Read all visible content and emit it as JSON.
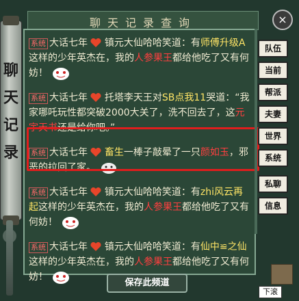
{
  "window": {
    "title": "聊天记录查询",
    "side_title": "聊天记录"
  },
  "buttons": {
    "close": "×",
    "save": "保存此频道",
    "scroll_down": "下滚"
  },
  "side_tabs": [
    "队伍",
    "当前",
    "帮派",
    "夫妻",
    "世界",
    "系统",
    "私聊",
    "信息"
  ],
  "messages": [
    {
      "tag": "系统",
      "parts": [
        "大话七年",
        "镇元大仙哈哈笑道：有",
        "师傅升级A",
        "这样的少年英杰在，我的",
        "人参果王",
        "都给他吃了又有何妨！"
      ]
    },
    {
      "tag": "系统",
      "parts": [
        "大话七年",
        "托塔李天王对",
        "SB点我11",
        "哭道：“我家哪吒玩性都突破2000大关了，洗不回去了，这",
        "元宇天书",
        "还是给你吧。”"
      ]
    },
    {
      "tag": "系统",
      "parts": [
        "大话七年",
        "畜生",
        "一棒子敲晕了一只",
        "颜如玉",
        "，邪恶的拉回了家。"
      ]
    },
    {
      "tag": "系统",
      "parts": [
        "大话七年",
        "镇元大仙哈哈笑道：有",
        "zhi风云再起",
        "这样的少年英杰在，我的",
        "人参果王",
        "都给他吃了又有何妨！"
      ]
    },
    {
      "tag": "系统",
      "parts": [
        "大话七年",
        "镇元大仙哈哈笑道：有",
        "仙中≌之仙",
        "这样的少年英杰在，我的",
        "人参果王",
        "都给他吃了又有何妨！"
      ]
    }
  ],
  "colors": {
    "panel": "#2b4737",
    "accent_red": "#ff3f3f",
    "player_yellow": "#ffe566",
    "highlight_border": "#e11d1d"
  }
}
